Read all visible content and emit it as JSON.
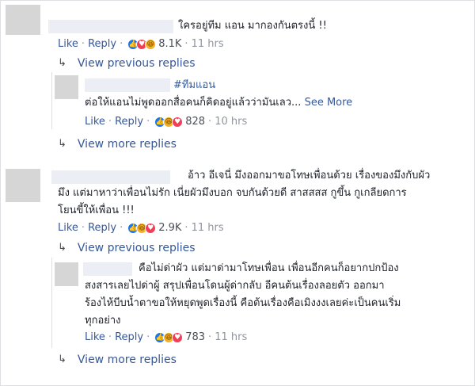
{
  "comments": [
    {
      "text_lines": [
        "ใครอยู่ทีม แอน มากองกันตรงนี้ !!"
      ],
      "like": "Like",
      "reply": "Reply",
      "reactions": [
        "like-icon",
        "love-icon",
        "haha-icon"
      ],
      "count": "8.1K",
      "time": "11 hrs"
    },
    {
      "hashtag": "#ทีมแอน",
      "text_lines": [
        "ต่อให้แอนไม่พูดออกสื่อคนก็คิดอยู่แล้วว่ามันเลว..."
      ],
      "see_more": "See More",
      "like": "Like",
      "reply": "Reply",
      "reactions": [
        "like-icon",
        "haha-icon",
        "love-icon"
      ],
      "count": "828",
      "time": "10 hrs"
    },
    {
      "text_lines": [
        "อ้าว อีเจนี่ มึงออกมาขอโทษเพื่อนด้วย เรื่องของมึงกับผัว",
        "มึง แต่มาหาว่าเพื่อนไม่รัก เนี่ยผัวมึงบอก จบกันด้วยดี สาสสสส กูขึ้น กูเกลียดการ",
        "โยนขี้ให้เพื่อน !!!"
      ],
      "like": "Like",
      "reply": "Reply",
      "reactions": [
        "like-icon",
        "haha-icon",
        "love-icon"
      ],
      "count": "2.9K",
      "time": "11 hrs"
    },
    {
      "text_lines": [
        "คือไม่ด่าผัว แต่มาด่ามาโทษเพื่อน เพื่อนอีกคนก็อยากปกป้อง",
        "สงสารเลยไปด่าผู้ สรุปเพื่อนโดนผู้ด่ากลับ อีคนต้นเรื่องลอยตัว ออกมา",
        "ร้องไห้บีบน้ำตาขอให้หยุดพูดเรื่องนี้ คือต้นเรื่องคือเมิงงงเลยค่ะเป็นคนเริ่ม",
        "ทุกอย่าง"
      ],
      "like": "Like",
      "reply": "Reply",
      "reactions": [
        "like-icon",
        "haha-icon",
        "love-icon"
      ],
      "count": "783",
      "time": "11 hrs"
    }
  ],
  "links": {
    "view_previous_1": "View previous replies",
    "view_more_1": "View more replies",
    "view_previous_2": "View previous replies",
    "view_more_2": "View more replies"
  }
}
